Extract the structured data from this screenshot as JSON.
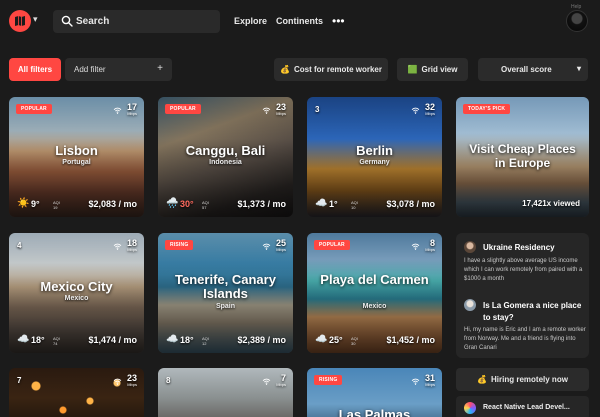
{
  "header": {
    "search_placeholder": "Search",
    "nav": [
      "Explore",
      "Continents"
    ],
    "more": "•••",
    "help_tag": "Help"
  },
  "filters": {
    "all_filters": "All filters",
    "add_filter": "Add filter",
    "add_icon": "+",
    "cost_label": "Cost for remote worker",
    "cost_icon": "💰",
    "grid_label": "Grid view",
    "grid_icon": "🟩",
    "sort_label": "Overall score",
    "sort_caret": "▾"
  },
  "cards": [
    {
      "title": "Lisbon",
      "country": "Portugal",
      "badge": "POPULAR",
      "speed": "17",
      "speed_unit": "Mbps",
      "weather": "☀️",
      "temp": "9°",
      "aqi_label": "AQI",
      "aqi": "19",
      "cost": "$2,083 / mo"
    },
    {
      "title": "Canggu, Bali",
      "country": "Indonesia",
      "badge": "POPULAR",
      "speed": "23",
      "speed_unit": "Mbps",
      "weather": "🌧️",
      "temp": "30°",
      "aqi_label": "AQI",
      "aqi": "57",
      "cost": "$1,373 / mo"
    },
    {
      "title": "Berlin",
      "country": "Germany",
      "rank": "3",
      "speed": "32",
      "speed_unit": "Mbps",
      "weather": "☁️",
      "temp": "1°",
      "aqi_label": "AQI",
      "aqi": "10",
      "cost": "$3,078 / mo"
    },
    {
      "title": "Visit Cheap Places in Europe",
      "badge": "TODAY'S PICK",
      "viewed": "17,421x viewed"
    },
    {
      "title": "Mexico City",
      "country": "Mexico",
      "rank": "4",
      "speed": "18",
      "speed_unit": "Mbps",
      "weather": "☁️",
      "temp": "18°",
      "aqi_label": "AQI",
      "aqi": "74",
      "cost": "$1,474 / mo"
    },
    {
      "title": "Tenerife, Canary Islands",
      "country": "Spain",
      "badge": "RISING",
      "speed": "25",
      "speed_unit": "Mbps",
      "weather": "☁️",
      "temp": "18°",
      "aqi_label": "AQI",
      "aqi": "12",
      "cost": "$2,389 / mo"
    },
    {
      "title": "Playa del Carmen",
      "country": "Mexico",
      "badge": "POPULAR",
      "speed": "8",
      "speed_unit": "Mbps",
      "weather": "☁️",
      "temp": "25°",
      "aqi_label": "AQI",
      "aqi": "30",
      "cost": "$1,452 / mo"
    },
    {
      "rank": "7",
      "speed": "23",
      "speed_unit": "Mbps"
    },
    {
      "rank": "8",
      "speed": "7",
      "speed_unit": "Mbps"
    },
    {
      "title": "Las Palmas",
      "badge": "RISING",
      "speed": "31",
      "speed_unit": "Mbps"
    }
  ],
  "posts": [
    {
      "title": "Ukraine Residency",
      "body": "I have a slightly above average US income which I can work remotely from paired with a $1000 a month"
    },
    {
      "title": "Is La Gomera a nice place to stay?",
      "body": "Hi, my name is Eric and I am a remote worker from Norway. Me and a friend is flying into Gran Canari"
    }
  ],
  "hiring": {
    "label": "Hiring remotely now",
    "icon": "💰"
  },
  "job": {
    "title": "React Native Lead Devel..."
  },
  "colors": {
    "accent": "#ff4742",
    "background": "#1b1b1b",
    "panel": "#2b2b2b"
  }
}
